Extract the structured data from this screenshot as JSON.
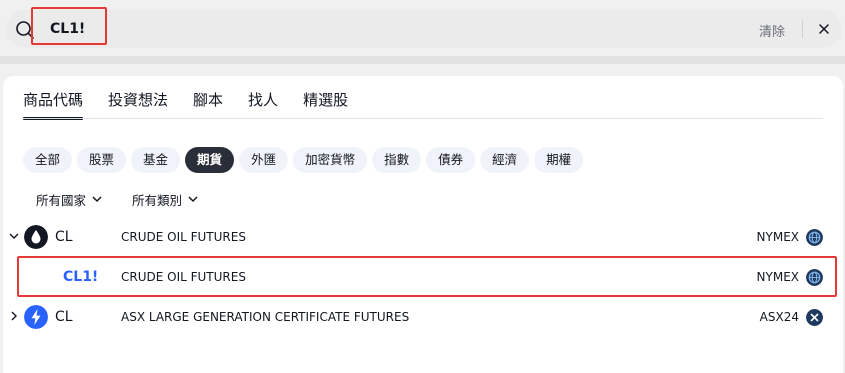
{
  "search": {
    "query": "CL1!",
    "clear_label": "清除"
  },
  "tabs": [
    {
      "label": "商品代碼",
      "active": true
    },
    {
      "label": "投資想法",
      "active": false
    },
    {
      "label": "腳本",
      "active": false
    },
    {
      "label": "找人",
      "active": false
    },
    {
      "label": "精選股",
      "active": false
    }
  ],
  "chips": [
    {
      "label": "全部",
      "active": false
    },
    {
      "label": "股票",
      "active": false
    },
    {
      "label": "基金",
      "active": false
    },
    {
      "label": "期貨",
      "active": true
    },
    {
      "label": "外匯",
      "active": false
    },
    {
      "label": "加密貨幣",
      "active": false
    },
    {
      "label": "指數",
      "active": false
    },
    {
      "label": "債券",
      "active": false
    },
    {
      "label": "經濟",
      "active": false
    },
    {
      "label": "期權",
      "active": false
    }
  ],
  "filters": {
    "country": "所有國家",
    "type": "所有類別"
  },
  "results": [
    {
      "symbol": "CL",
      "description": "CRUDE OIL FUTURES",
      "exchange": "NYMEX",
      "logo_icon": "oil-drop-icon",
      "expander": "chevron-down-icon",
      "logo_color": "#131722"
    },
    {
      "symbol": "CL1!",
      "description": "CRUDE OIL FUTURES",
      "exchange": "NYMEX",
      "highlighted": true
    },
    {
      "symbol": "CL",
      "description": "ASX LARGE GENERATION CERTIFICATE FUTURES",
      "exchange": "ASX24",
      "logo_icon": "lightning-icon",
      "expander": "chevron-right-icon",
      "logo_color": "#2962ff"
    }
  ],
  "colors": {
    "accent": "#2962ff",
    "highlight_border": "#e53935",
    "active_chip": "#2a2e39"
  }
}
